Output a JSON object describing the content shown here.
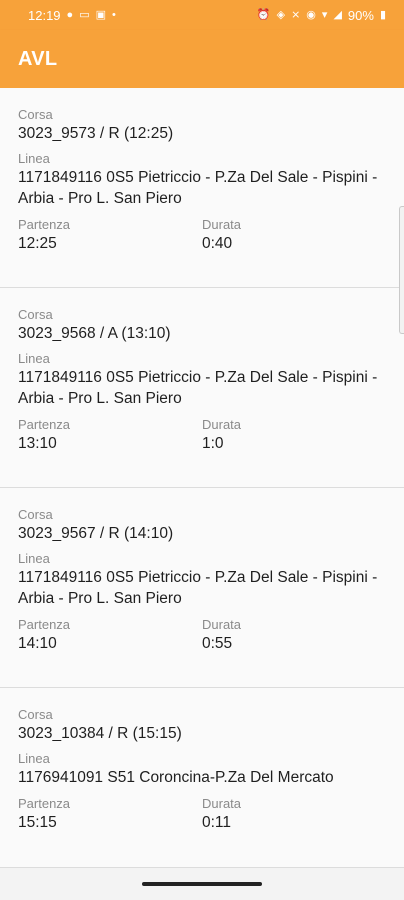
{
  "status_bar": {
    "time": "12:19",
    "left_icons": [
      "whatsapp-icon",
      "laptop-icon",
      "instagram-icon",
      "dot-icon"
    ],
    "right_icons": [
      "alarm-icon",
      "nfc-icon",
      "mute-icon",
      "location-icon",
      "wifi-icon",
      "signal-icon"
    ],
    "battery": "90%"
  },
  "app_bar": {
    "title": "AVL",
    "color": "#f7a23a"
  },
  "trips": [
    {
      "corsa_label": "Corsa",
      "corsa": "3023_9573 / R (12:25)",
      "linea_label": "Linea",
      "linea": "1171849116 0S5 Pietriccio - P.Za Del Sale - Pispini - Arbia - Pro L. San Piero",
      "partenza_label": "Partenza",
      "partenza": "12:25",
      "durata_label": "Durata",
      "durata": "0:40"
    },
    {
      "corsa_label": "Corsa",
      "corsa": "3023_9568 / A (13:10)",
      "linea_label": "Linea",
      "linea": "1171849116 0S5 Pietriccio - P.Za Del Sale - Pispini - Arbia - Pro L. San Piero",
      "partenza_label": "Partenza",
      "partenza": "13:10",
      "durata_label": "Durata",
      "durata": "1:0"
    },
    {
      "corsa_label": "Corsa",
      "corsa": "3023_9567 / R (14:10)",
      "linea_label": "Linea",
      "linea": "1171849116 0S5 Pietriccio - P.Za Del Sale - Pispini - Arbia - Pro L. San Piero",
      "partenza_label": "Partenza",
      "partenza": "14:10",
      "durata_label": "Durata",
      "durata": "0:55"
    },
    {
      "corsa_label": "Corsa",
      "corsa": "3023_10384 / R (15:15)",
      "linea_label": "Linea",
      "linea": "1176941091 S51 Coroncina-P.Za Del Mercato",
      "partenza_label": "Partenza",
      "partenza": "15:15",
      "durata_label": "Durata",
      "durata": "0:11"
    }
  ]
}
